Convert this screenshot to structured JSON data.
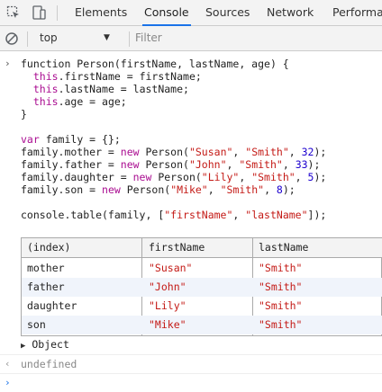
{
  "tabs": [
    {
      "label": "Elements"
    },
    {
      "label": "Console",
      "active": true
    },
    {
      "label": "Sources"
    },
    {
      "label": "Network"
    },
    {
      "label": "Performa"
    }
  ],
  "toolbar": {
    "inspect_icon": "inspect-element-icon",
    "device_icon": "device-toolbar-icon",
    "clear_icon": "clear-console-icon",
    "context_value": "top",
    "filter_placeholder": "Filter"
  },
  "console": {
    "input_code": [
      [
        [
          "plain",
          "function Person(firstName, lastName, age) {"
        ]
      ],
      [
        [
          "plain",
          "  "
        ],
        [
          "kw",
          "this"
        ],
        [
          "plain",
          ".firstName = firstName;"
        ]
      ],
      [
        [
          "plain",
          "  "
        ],
        [
          "kw",
          "this"
        ],
        [
          "plain",
          ".lastName = lastName;"
        ]
      ],
      [
        [
          "plain",
          "  "
        ],
        [
          "kw",
          "this"
        ],
        [
          "plain",
          ".age = age;"
        ]
      ],
      [
        [
          "plain",
          "}"
        ]
      ],
      [
        [
          "plain",
          ""
        ]
      ],
      [
        [
          "kw",
          "var"
        ],
        [
          "plain",
          " family = {};"
        ]
      ],
      [
        [
          "plain",
          "family.mother = "
        ],
        [
          "kw",
          "new"
        ],
        [
          "plain",
          " Person("
        ],
        [
          "str",
          "\"Susan\""
        ],
        [
          "plain",
          ", "
        ],
        [
          "str",
          "\"Smith\""
        ],
        [
          "plain",
          ", "
        ],
        [
          "num",
          "32"
        ],
        [
          "plain",
          ");"
        ]
      ],
      [
        [
          "plain",
          "family.father = "
        ],
        [
          "kw",
          "new"
        ],
        [
          "plain",
          " Person("
        ],
        [
          "str",
          "\"John\""
        ],
        [
          "plain",
          ", "
        ],
        [
          "str",
          "\"Smith\""
        ],
        [
          "plain",
          ", "
        ],
        [
          "num",
          "33"
        ],
        [
          "plain",
          ");"
        ]
      ],
      [
        [
          "plain",
          "family.daughter = "
        ],
        [
          "kw",
          "new"
        ],
        [
          "plain",
          " Person("
        ],
        [
          "str",
          "\"Lily\""
        ],
        [
          "plain",
          ", "
        ],
        [
          "str",
          "\"Smith\""
        ],
        [
          "plain",
          ", "
        ],
        [
          "num",
          "5"
        ],
        [
          "plain",
          ");"
        ]
      ],
      [
        [
          "plain",
          "family.son = "
        ],
        [
          "kw",
          "new"
        ],
        [
          "plain",
          " Person("
        ],
        [
          "str",
          "\"Mike\""
        ],
        [
          "plain",
          ", "
        ],
        [
          "str",
          "\"Smith\""
        ],
        [
          "plain",
          ", "
        ],
        [
          "num",
          "8"
        ],
        [
          "plain",
          ");"
        ]
      ],
      [
        [
          "plain",
          ""
        ]
      ],
      [
        [
          "plain",
          "console.table(family, ["
        ],
        [
          "str",
          "\"firstName\""
        ],
        [
          "plain",
          ", "
        ],
        [
          "str",
          "\"lastName\""
        ],
        [
          "plain",
          "]);"
        ]
      ]
    ],
    "table": {
      "headers": [
        "(index)",
        "firstName",
        "lastName"
      ],
      "rows": [
        [
          "mother",
          "\"Susan\"",
          "\"Smith\""
        ],
        [
          "father",
          "\"John\"",
          "\"Smith\""
        ],
        [
          "daughter",
          "\"Lily\"",
          "\"Smith\""
        ],
        [
          "son",
          "\"Mike\"",
          "\"Smith\""
        ]
      ]
    },
    "object_label": "Object",
    "return_value": "undefined"
  },
  "colors": {
    "accent": "#1a73e8",
    "keyword": "#aa0d91",
    "string": "#c41a16",
    "number": "#1c00cf"
  }
}
